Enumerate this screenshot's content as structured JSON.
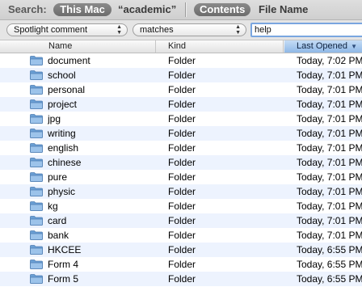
{
  "scope": {
    "label": "Search:",
    "this_mac": "This Mac",
    "academic": "“academic”",
    "contents": "Contents",
    "file_name": "File Name"
  },
  "criteria": {
    "attribute": "Spotlight comment",
    "operator": "matches",
    "value": "help"
  },
  "columns": {
    "name": "Name",
    "kind": "Kind",
    "last_opened": "Last Opened"
  },
  "rows": [
    {
      "name": "document",
      "kind": "Folder",
      "last_opened": "Today, 7:02 PM"
    },
    {
      "name": "school",
      "kind": "Folder",
      "last_opened": "Today, 7:01 PM"
    },
    {
      "name": "personal",
      "kind": "Folder",
      "last_opened": "Today, 7:01 PM"
    },
    {
      "name": "project",
      "kind": "Folder",
      "last_opened": "Today, 7:01 PM"
    },
    {
      "name": "jpg",
      "kind": "Folder",
      "last_opened": "Today, 7:01 PM"
    },
    {
      "name": "writing",
      "kind": "Folder",
      "last_opened": "Today, 7:01 PM"
    },
    {
      "name": "english",
      "kind": "Folder",
      "last_opened": "Today, 7:01 PM"
    },
    {
      "name": "chinese",
      "kind": "Folder",
      "last_opened": "Today, 7:01 PM"
    },
    {
      "name": "pure",
      "kind": "Folder",
      "last_opened": "Today, 7:01 PM"
    },
    {
      "name": "physic",
      "kind": "Folder",
      "last_opened": "Today, 7:01 PM"
    },
    {
      "name": "kg",
      "kind": "Folder",
      "last_opened": "Today, 7:01 PM"
    },
    {
      "name": "card",
      "kind": "Folder",
      "last_opened": "Today, 7:01 PM"
    },
    {
      "name": "bank",
      "kind": "Folder",
      "last_opened": "Today, 7:01 PM"
    },
    {
      "name": "HKCEE",
      "kind": "Folder",
      "last_opened": "Today, 6:55 PM"
    },
    {
      "name": "Form 4",
      "kind": "Folder",
      "last_opened": "Today, 6:55 PM"
    },
    {
      "name": "Form 5",
      "kind": "Folder",
      "last_opened": "Today, 6:55 PM"
    }
  ],
  "icons": {
    "folder": "folder-icon",
    "popup_arrows": "popup-arrows-icon",
    "sort": "sort-arrow-icon"
  },
  "colors": {
    "row_stripe": "#edf3fe",
    "sorted_header": "#8fb8e6",
    "scope_pill": "#7a7a7a",
    "folder": "#7faedc"
  }
}
